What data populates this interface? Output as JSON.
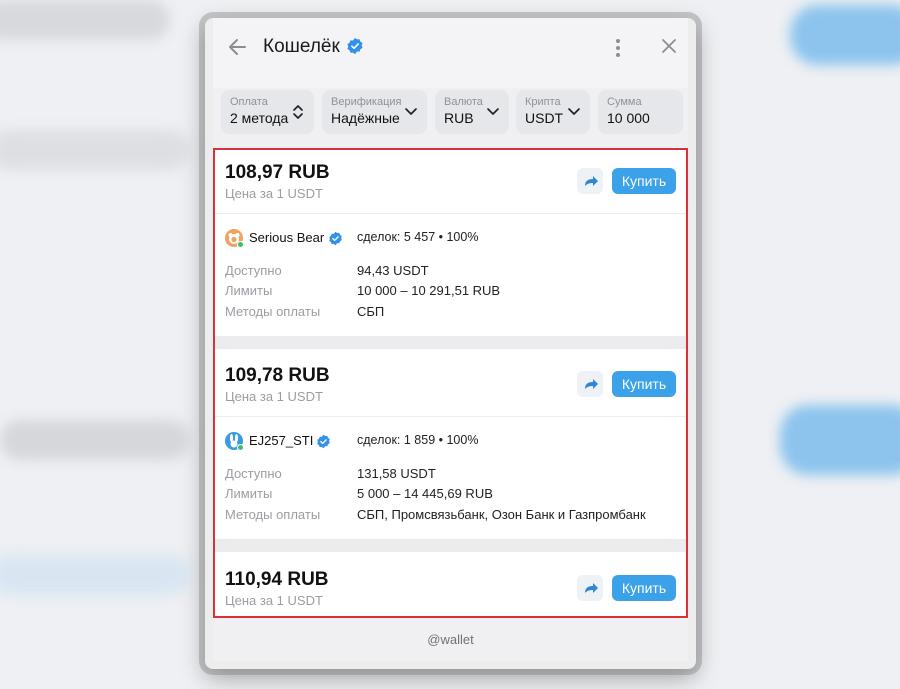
{
  "app": {
    "title": "Кошелёк",
    "footer": "@wallet",
    "accent": "#3ba1e8",
    "highlight": "#d9303a"
  },
  "filters": [
    {
      "label": "Оплата",
      "value": "2 метода",
      "icon": "sort-updown-icon"
    },
    {
      "label": "Верификация",
      "value": "Надёжные",
      "icon": "chevron-down-icon"
    },
    {
      "label": "Валюта",
      "value": "RUB",
      "icon": "chevron-down-icon"
    },
    {
      "label": "Крипта",
      "value": "USDT",
      "icon": "chevron-down-icon"
    },
    {
      "label": "Сумма",
      "value": "10 000",
      "icon": ""
    }
  ],
  "offers": [
    {
      "price": "108,97 RUB",
      "unit": "Цена за 1 USDT",
      "buy_label": "Купить",
      "seller": "Serious Bear",
      "deals": "сделок: 5 457 • 100%",
      "available_label": "Доступно",
      "available": "94,43 USDT",
      "limits_label": "Лимиты",
      "limits": "10 000 – 10 291,51 RUB",
      "methods_label": "Методы оплаты",
      "methods": "СБП"
    },
    {
      "price": "109,78 RUB",
      "unit": "Цена за 1 USDT",
      "buy_label": "Купить",
      "seller": "EJ257_STI",
      "deals": "сделок: 1 859 • 100%",
      "available_label": "Доступно",
      "available": "131,58 USDT",
      "limits_label": "Лимиты",
      "limits": "5 000 – 14 445,69 RUB",
      "methods_label": "Методы оплаты",
      "methods": "СБП, Промсвязьбанк, Озон Банк и Газпромбанк"
    },
    {
      "price": "110,94 RUB",
      "unit": "Цена за 1 USDT",
      "buy_label": "Купить"
    }
  ]
}
